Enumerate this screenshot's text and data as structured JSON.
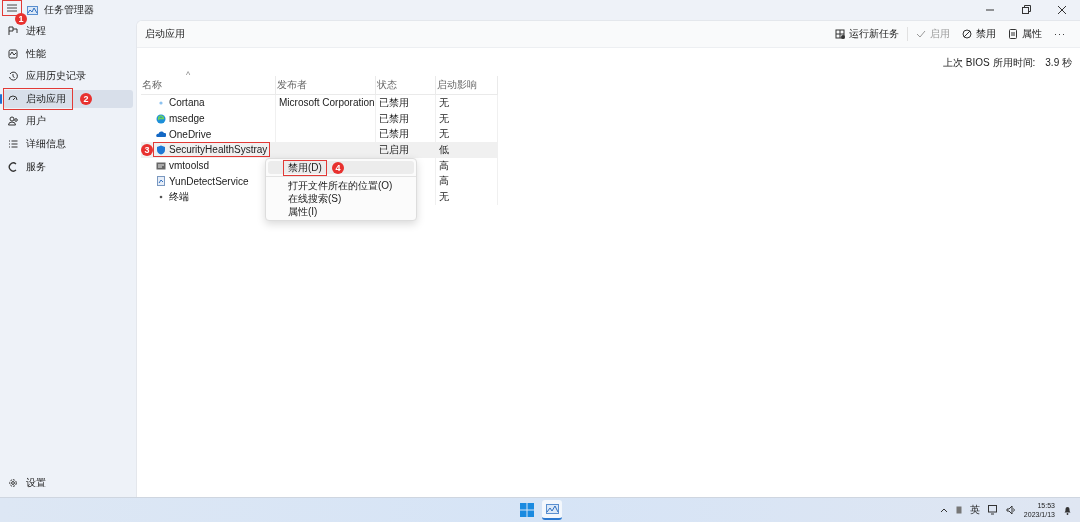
{
  "window": {
    "title": "任务管理器",
    "menu_annotation": "1"
  },
  "sidebar": {
    "items": [
      {
        "label": "进程",
        "selected": false
      },
      {
        "label": "性能",
        "selected": false
      },
      {
        "label": "应用历史记录",
        "selected": false
      },
      {
        "label": "启动应用",
        "selected": true,
        "annotation": "2"
      },
      {
        "label": "用户",
        "selected": false
      },
      {
        "label": "详细信息",
        "selected": false
      },
      {
        "label": "服务",
        "selected": false
      }
    ],
    "settings": "设置"
  },
  "header": {
    "title": "启动应用",
    "toolbar": [
      {
        "label": "运行新任务",
        "disabled": false
      },
      {
        "label": "启用",
        "disabled": true
      },
      {
        "label": "禁用",
        "disabled": false
      },
      {
        "label": "属性",
        "disabled": false
      }
    ],
    "more": "···"
  },
  "bios": {
    "label": "上次 BIOS 所用时间:",
    "value": "3.9 秒"
  },
  "table": {
    "sort_caret": "^",
    "columns": [
      "名称",
      "发布者",
      "状态",
      "启动影响"
    ],
    "rows": [
      {
        "name": "Cortana",
        "publisher": "Microsoft Corporation",
        "status": "已禁用",
        "impact": "无",
        "selected": false
      },
      {
        "name": "msedge",
        "status": "已禁用",
        "impact": "无",
        "selected": false
      },
      {
        "name": "OneDrive",
        "status": "已禁用",
        "impact": "无",
        "selected": false
      },
      {
        "name": "SecurityHealthSystray",
        "status": "已启用",
        "impact": "低",
        "selected": true,
        "annotation": "3"
      },
      {
        "name": "vmtoolsd",
        "impact": "高",
        "selected": false
      },
      {
        "name": "YunDetectService",
        "impact": "高",
        "selected": false
      },
      {
        "name": "终端",
        "impact": "无",
        "selected": false
      }
    ]
  },
  "context_menu": {
    "items": [
      {
        "label": "禁用(D)",
        "selected": true,
        "annotation": "4"
      },
      {
        "label": "打开文件所在的位置(O)",
        "selected": false
      },
      {
        "label": "在线搜索(S)",
        "selected": false
      },
      {
        "label": "属性(I)",
        "selected": false
      }
    ]
  },
  "taskbar": {
    "ime": "英",
    "time": "15:53",
    "date": "2023/1/13"
  }
}
